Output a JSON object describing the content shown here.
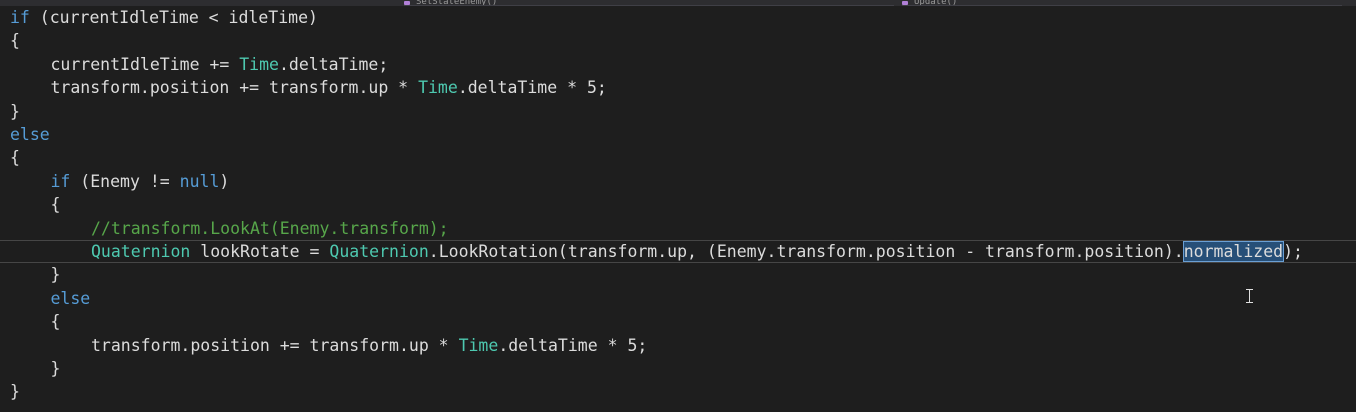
{
  "navigation": {
    "left_dropdown": "SetStateEnemy()",
    "right_dropdown": "Update()"
  },
  "code_lines": [
    {
      "indent": 0,
      "tokens": [
        [
          "k",
          "if"
        ],
        [
          "p",
          " (currentIdleTime < idleTime)"
        ]
      ]
    },
    {
      "indent": 0,
      "tokens": [
        [
          "p",
          "{"
        ]
      ]
    },
    {
      "indent": 1,
      "tokens": [
        [
          "p",
          "currentIdleTime += "
        ],
        [
          "t",
          "Time"
        ],
        [
          "p",
          ".deltaTime;"
        ]
      ]
    },
    {
      "indent": 1,
      "tokens": [
        [
          "p",
          "transform.position += transform.up * "
        ],
        [
          "t",
          "Time"
        ],
        [
          "p",
          ".deltaTime * 5;"
        ]
      ]
    },
    {
      "indent": 0,
      "tokens": [
        [
          "p",
          "}"
        ]
      ]
    },
    {
      "indent": 0,
      "tokens": [
        [
          "k",
          "else"
        ]
      ]
    },
    {
      "indent": 0,
      "tokens": [
        [
          "p",
          "{"
        ]
      ]
    },
    {
      "indent": 1,
      "tokens": [
        [
          "k",
          "if"
        ],
        [
          "p",
          " (Enemy != "
        ],
        [
          "k",
          "null"
        ],
        [
          "p",
          ")"
        ]
      ]
    },
    {
      "indent": 1,
      "tokens": [
        [
          "p",
          "{"
        ]
      ]
    },
    {
      "indent": 2,
      "tokens": [
        [
          "c",
          "//transform.LookAt(Enemy.transform);"
        ]
      ]
    },
    {
      "indent": 2,
      "current": true,
      "tokens": [
        [
          "t",
          "Quaternion"
        ],
        [
          "p",
          " lookRotate = "
        ],
        [
          "t",
          "Quaternion"
        ],
        [
          "p",
          ".LookRotation(transform.up, (Enemy.transform.position - transform.position)."
        ],
        [
          "sel",
          "normalized"
        ],
        [
          "p",
          ");"
        ]
      ]
    },
    {
      "indent": 1,
      "tokens": [
        [
          "p",
          "}"
        ]
      ]
    },
    {
      "indent": 1,
      "tokens": [
        [
          "k",
          "else"
        ]
      ]
    },
    {
      "indent": 1,
      "tokens": [
        [
          "p",
          "{"
        ]
      ]
    },
    {
      "indent": 2,
      "tokens": [
        [
          "p",
          "transform.position += transform.up * "
        ],
        [
          "t",
          "Time"
        ],
        [
          "p",
          ".deltaTime * 5;"
        ]
      ]
    },
    {
      "indent": 1,
      "tokens": [
        [
          "p",
          "}"
        ]
      ]
    },
    {
      "indent": 0,
      "tokens": [
        [
          "p",
          "}"
        ]
      ]
    }
  ],
  "colors": {
    "background": "#1e1e1e",
    "keyword": "#569cd6",
    "type": "#4ec9b0",
    "comment": "#57a64a",
    "plain": "#dcdcdc",
    "selection": "#264f78"
  },
  "cursor_icon": "text-ibeam-cursor"
}
